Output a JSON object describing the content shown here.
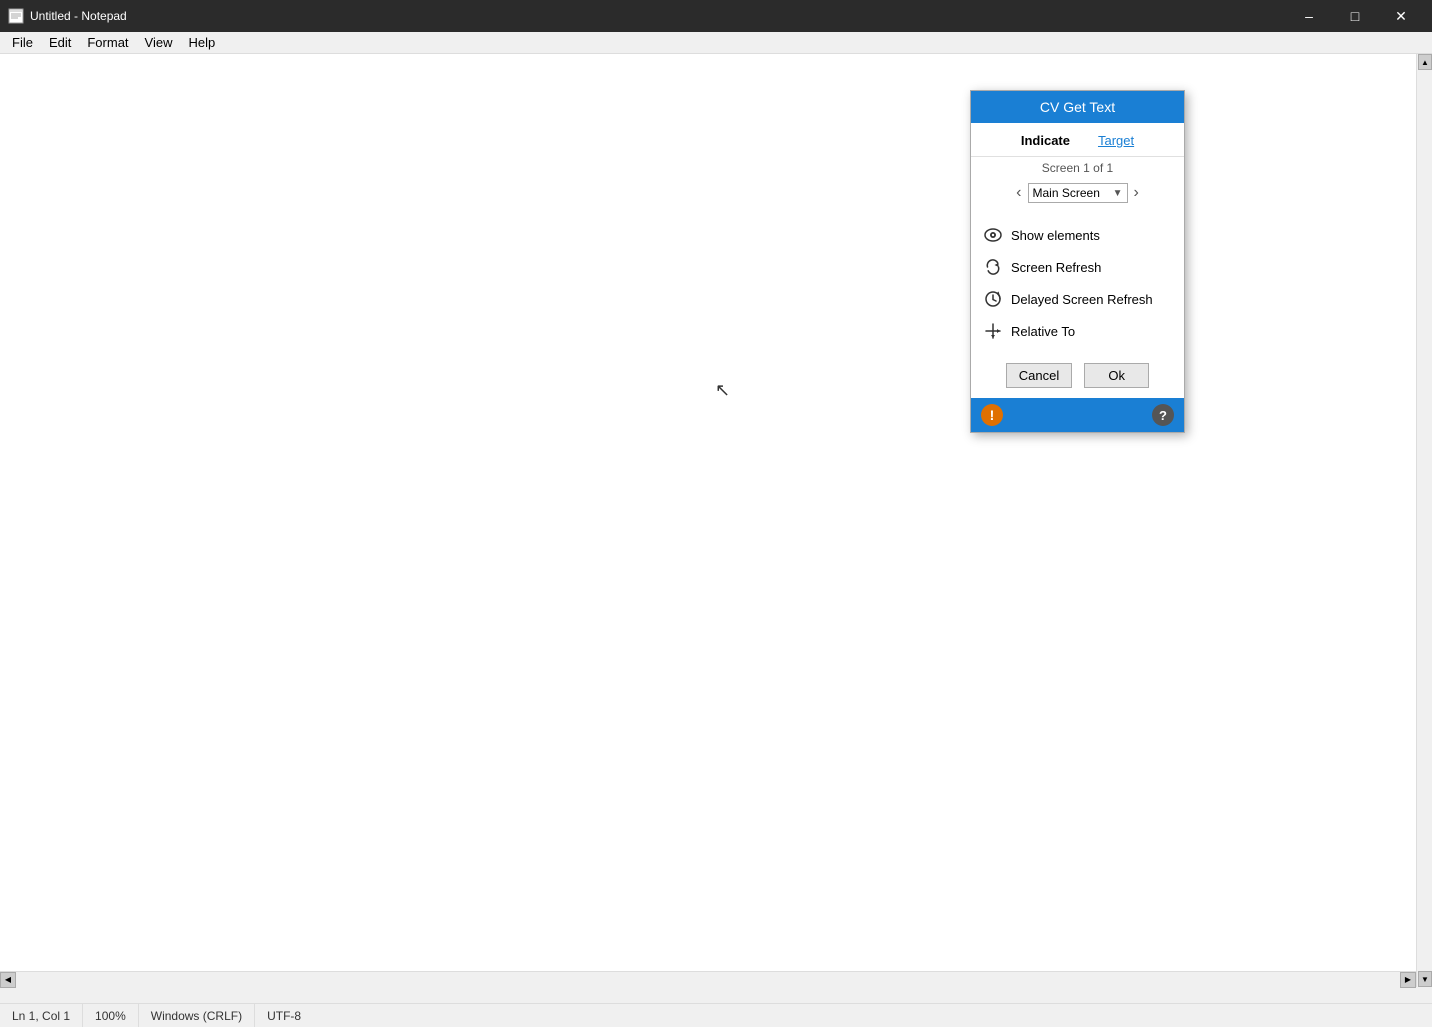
{
  "window": {
    "title": "Untitled - Notepad",
    "icon": "📄"
  },
  "titlebar": {
    "minimize_label": "–",
    "maximize_label": "□",
    "close_label": "✕"
  },
  "menubar": {
    "items": [
      {
        "label": "File"
      },
      {
        "label": "Edit"
      },
      {
        "label": "Format"
      },
      {
        "label": "View"
      },
      {
        "label": "Help"
      }
    ]
  },
  "statusbar": {
    "position": "Ln 1, Col 1",
    "zoom": "100%",
    "line_ending": "Windows (CRLF)",
    "encoding": "UTF-8"
  },
  "dialog": {
    "title": "CV Get Text",
    "tabs": [
      {
        "label": "Indicate",
        "active": true
      },
      {
        "label": "Target",
        "active": false
      }
    ],
    "screen_nav": {
      "screen_label": "Screen 1 of 1",
      "selected_screen": "Main Screen"
    },
    "options": [
      {
        "id": "show-elements",
        "icon": "👁",
        "label": "Show elements"
      },
      {
        "id": "screen-refresh",
        "icon": "↺",
        "label": "Screen Refresh"
      },
      {
        "id": "delayed-screen-refresh",
        "icon": "⏱",
        "label": "Delayed Screen Refresh"
      },
      {
        "id": "relative-to",
        "icon": "✛",
        "label": "Relative To"
      }
    ],
    "buttons": [
      {
        "label": "Cancel",
        "id": "cancel"
      },
      {
        "label": "Ok",
        "id": "ok"
      }
    ]
  }
}
